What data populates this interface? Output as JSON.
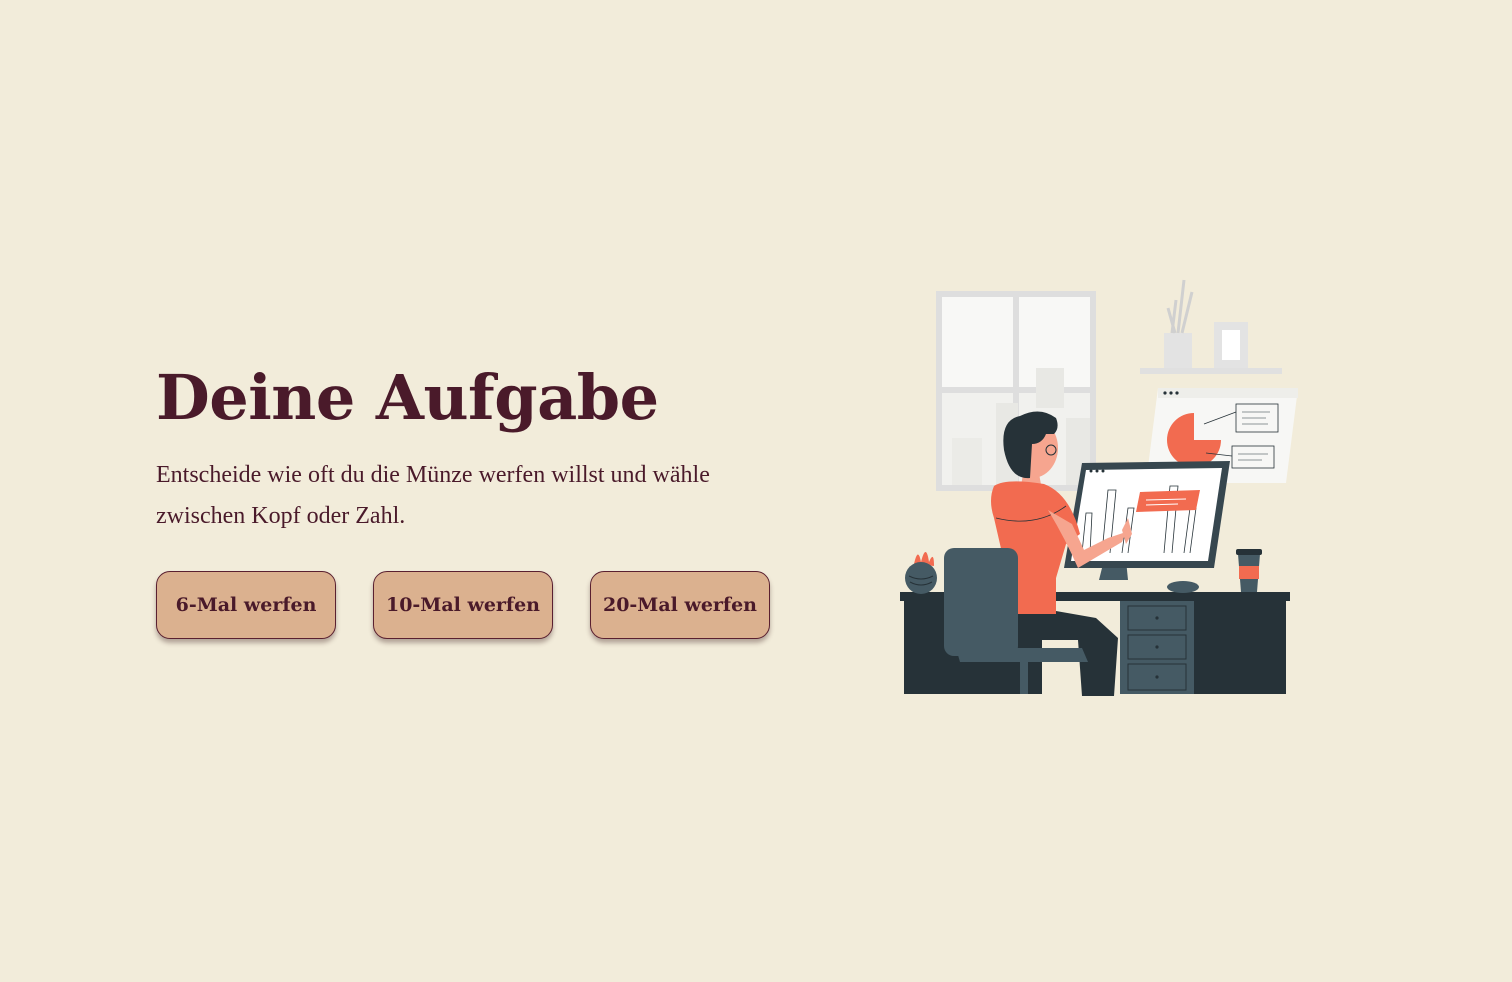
{
  "hero": {
    "title": "Deine Aufgabe",
    "description": "Entscheide wie oft du die Münze werfen willst und wähle zwischen Kopf oder Zahl."
  },
  "buttons": [
    {
      "label": "6-Mal werfen"
    },
    {
      "label": "10-Mal werfen"
    },
    {
      "label": "20-Mal werfen"
    }
  ],
  "illustration": {
    "icon": "person-at-computer-illustration"
  },
  "colors": {
    "background": "#f2ecda",
    "text": "#4a1a2a",
    "button": "#dbb18f",
    "accent": "#f26b50",
    "dark": "#263238",
    "chair": "#455a64"
  }
}
